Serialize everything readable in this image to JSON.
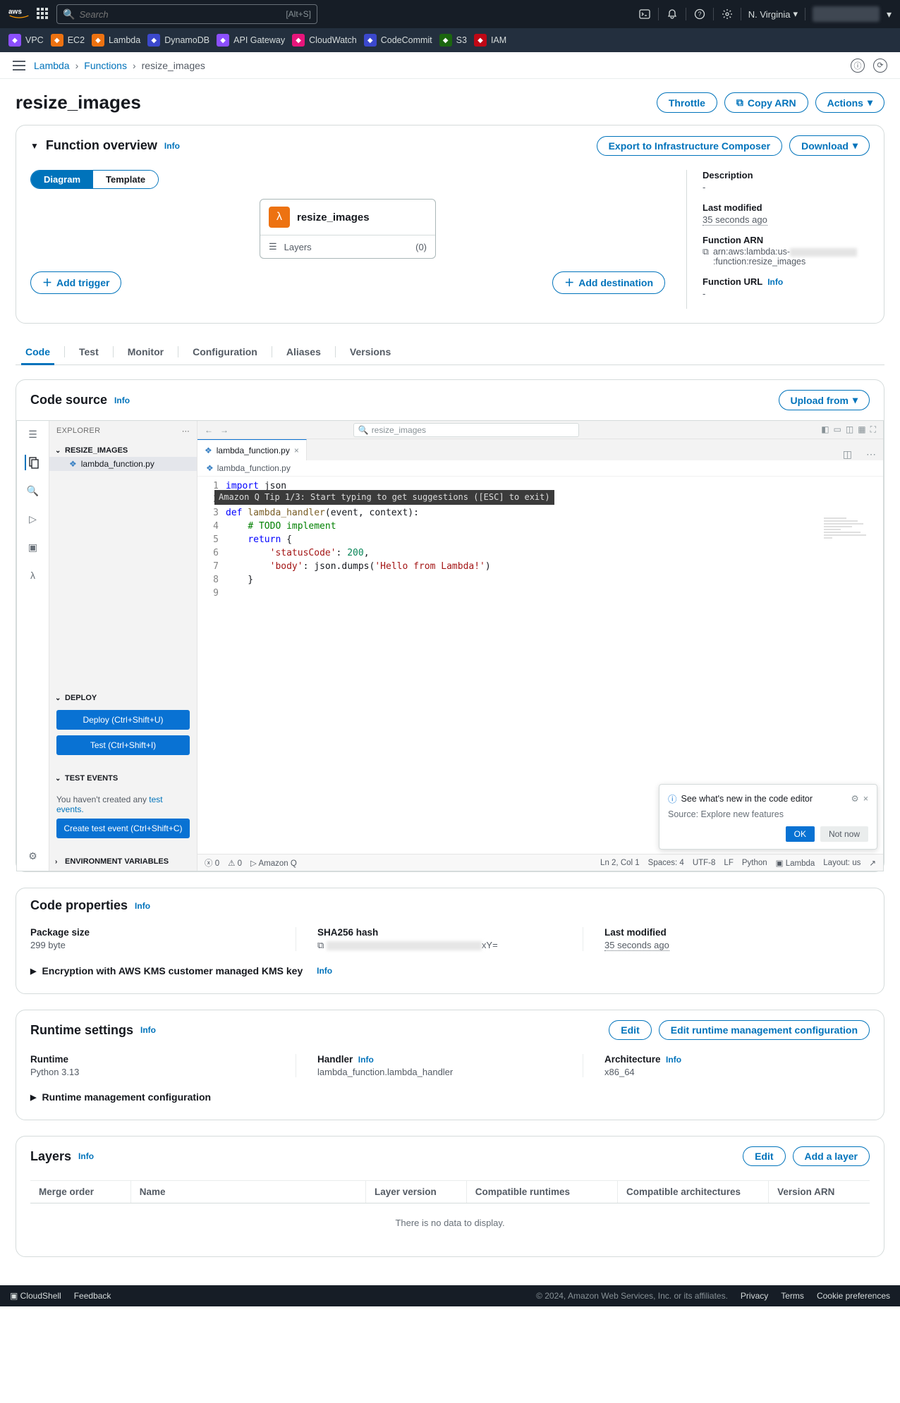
{
  "topnav": {
    "search_placeholder": "Search",
    "search_hint": "[Alt+S]",
    "region": "N. Virginia"
  },
  "services": [
    {
      "name": "VPC",
      "color": "#8c4fff"
    },
    {
      "name": "EC2",
      "color": "#ed7211"
    },
    {
      "name": "Lambda",
      "color": "#ed7211"
    },
    {
      "name": "DynamoDB",
      "color": "#3b48cc"
    },
    {
      "name": "API Gateway",
      "color": "#8c4fff"
    },
    {
      "name": "CloudWatch",
      "color": "#e7157b"
    },
    {
      "name": "CodeCommit",
      "color": "#3b48cc"
    },
    {
      "name": "S3",
      "color": "#1b660f"
    },
    {
      "name": "IAM",
      "color": "#bf0816"
    }
  ],
  "breadcrumbs": {
    "root": "Lambda",
    "mid": "Functions",
    "current": "resize_images"
  },
  "page": {
    "title": "resize_images",
    "throttle": "Throttle",
    "copy_arn": "Copy ARN",
    "actions": "Actions"
  },
  "overview": {
    "title": "Function overview",
    "info": "Info",
    "export_btn": "Export to Infrastructure Composer",
    "download_btn": "Download",
    "toggle_diagram": "Diagram",
    "toggle_template": "Template",
    "fn_name": "resize_images",
    "layers_label": "Layers",
    "layers_count": "(0)",
    "add_trigger": "Add trigger",
    "add_destination": "Add destination",
    "desc_label": "Description",
    "desc_val": "-",
    "mod_label": "Last modified",
    "mod_val": "35 seconds ago",
    "arn_label": "Function ARN",
    "arn_prefix": "arn:aws:lambda:us-",
    "arn_suffix": ":function:resize_images",
    "url_label": "Function URL",
    "url_info": "Info",
    "url_val": "-"
  },
  "tabs": [
    "Code",
    "Test",
    "Monitor",
    "Configuration",
    "Aliases",
    "Versions"
  ],
  "code_source": {
    "title": "Code source",
    "info": "Info",
    "upload": "Upload from"
  },
  "editor": {
    "explorer": "EXPLORER",
    "project": "RESIZE_IMAGES",
    "file": "lambda_function.py",
    "deploy_section": "DEPLOY",
    "deploy_btn": "Deploy (Ctrl+Shift+U)",
    "test_btn": "Test (Ctrl+Shift+I)",
    "testevents_section": "TEST EVENTS",
    "testevents_text": "You haven't created any ",
    "testevents_link": "test events.",
    "create_test_btn": "Create test event (Ctrl+Shift+C)",
    "env_section": "ENVIRONMENT VARIABLES",
    "search_ph": "resize_images",
    "tab_name": "lambda_function.py",
    "crumb": "lambda_function.py",
    "tip": "Amazon Q Tip 1/3: Start typing to get suggestions ([ESC] to exit)",
    "status_left_errors": "0",
    "status_left_warnings": "0",
    "status_amazonq": "Amazon Q",
    "status_ln": "Ln 2, Col 1",
    "status_spaces": "Spaces: 4",
    "status_enc": "UTF-8",
    "status_eol": "LF",
    "status_lang": "Python",
    "status_lambda": "Lambda",
    "status_layout": "Layout: us"
  },
  "whatsnew": {
    "title": "See what's new in the code editor",
    "source": "Source: Explore new features",
    "ok": "OK",
    "notnow": "Not now"
  },
  "code_props": {
    "title": "Code properties",
    "info": "Info",
    "pkg_label": "Package size",
    "pkg_val": "299 byte",
    "sha_label": "SHA256 hash",
    "sha_suffix": "xY=",
    "mod_label": "Last modified",
    "mod_val": "35 seconds ago",
    "encryption": "Encryption with AWS KMS customer managed KMS key",
    "encryption_info": "Info"
  },
  "runtime": {
    "title": "Runtime settings",
    "info": "Info",
    "edit": "Edit",
    "edit_mgmt": "Edit runtime management configuration",
    "rt_label": "Runtime",
    "rt_val": "Python 3.13",
    "handler_label": "Handler",
    "handler_info": "Info",
    "handler_val": "lambda_function.lambda_handler",
    "arch_label": "Architecture",
    "arch_info": "Info",
    "arch_val": "x86_64",
    "mgmt_config": "Runtime management configuration"
  },
  "layers": {
    "title": "Layers",
    "info": "Info",
    "edit": "Edit",
    "add": "Add a layer",
    "cols": [
      "Merge order",
      "Name",
      "Layer version",
      "Compatible runtimes",
      "Compatible architectures",
      "Version ARN"
    ],
    "empty": "There is no data to display."
  },
  "footer": {
    "cloudshell": "CloudShell",
    "feedback": "Feedback",
    "copyright": "© 2024, Amazon Web Services, Inc. or its affiliates.",
    "privacy": "Privacy",
    "terms": "Terms",
    "cookie": "Cookie preferences"
  }
}
